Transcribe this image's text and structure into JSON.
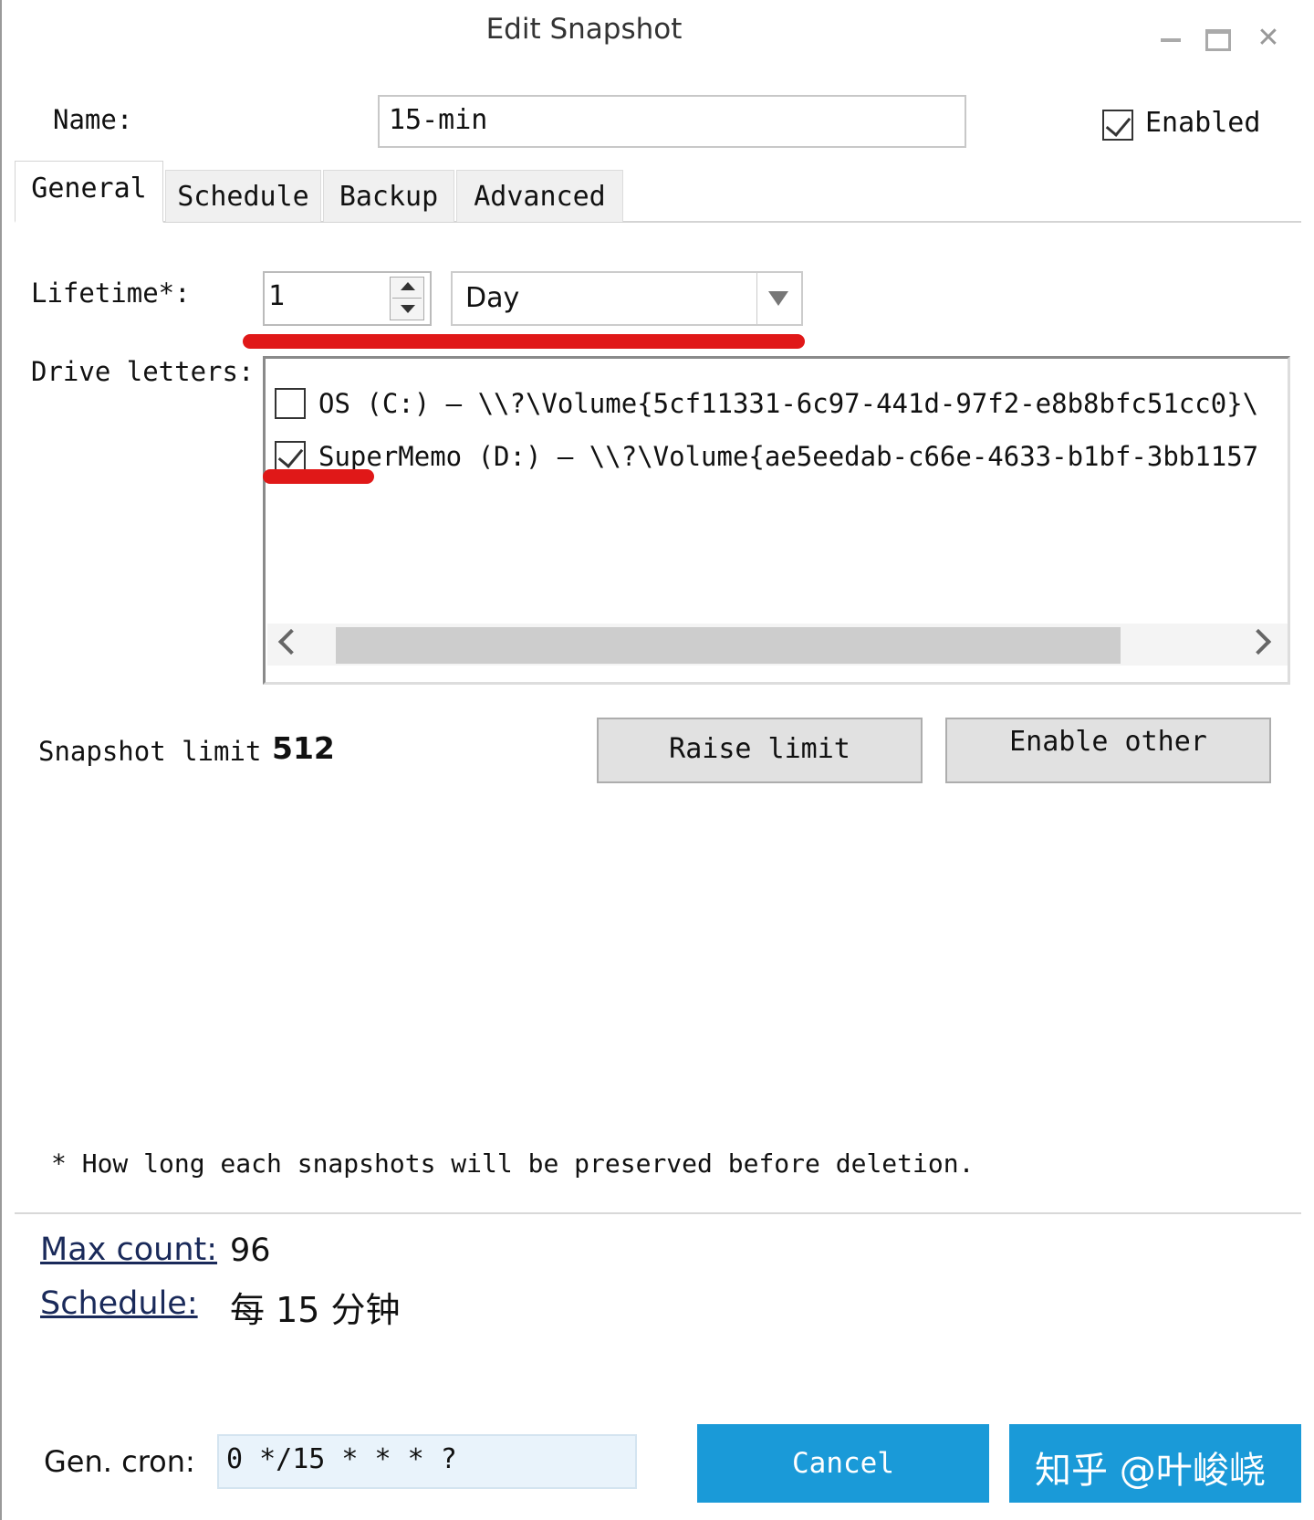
{
  "window": {
    "title": "Edit Snapshot"
  },
  "name_row": {
    "label": "Name:",
    "value": "15-min",
    "enabled_label": "Enabled",
    "enabled_checked": true
  },
  "tabs": [
    {
      "label": "General",
      "active": true
    },
    {
      "label": "Schedule",
      "active": false
    },
    {
      "label": "Backup",
      "active": false
    },
    {
      "label": "Advanced",
      "active": false
    }
  ],
  "lifetime": {
    "label": "Lifetime*:",
    "value": "1",
    "unit": "Day"
  },
  "drives": {
    "label": "Drive letters:",
    "items": [
      {
        "text": "OS (C:) — \\\\?\\Volume{5cf11331-6c97-441d-97f2-e8b8bfc51cc0}\\",
        "checked": false
      },
      {
        "text": "SuperMemo (D:) — \\\\?\\Volume{ae5eedab-c66e-4633-b1bf-3bb1157",
        "checked": true
      }
    ]
  },
  "limit": {
    "label": "Snapshot limit",
    "value": "512",
    "raise_label": "Raise limit",
    "enable_other_label": "Enable other"
  },
  "footnote": "* How long each snapshots will be preserved before deletion.",
  "summary": {
    "max_count_label": "Max count:",
    "max_count_value": "96",
    "schedule_label": "Schedule:",
    "schedule_value": "每 15 分钟"
  },
  "cron": {
    "label": "Gen. cron:",
    "value": "0 */15 * * * ?"
  },
  "buttons": {
    "cancel": "Cancel",
    "ok": ""
  },
  "watermark": "知乎 @叶峻峣",
  "colors": {
    "accent_button": "#1a9ad8",
    "annotation_red": "#e01818",
    "cron_field_bg": "#e9f3fb"
  }
}
